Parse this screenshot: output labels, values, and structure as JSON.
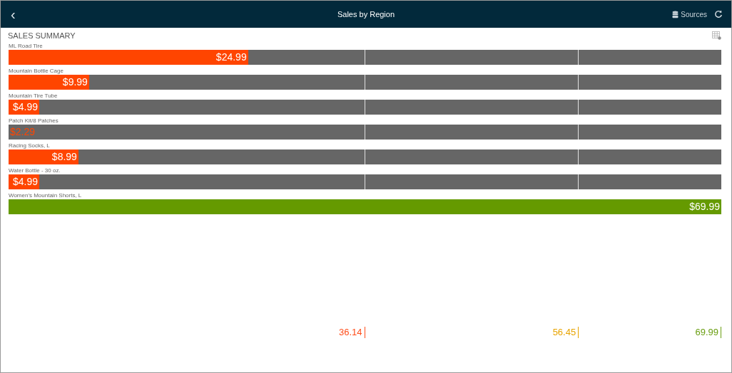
{
  "header": {
    "back": "‹",
    "title": "Sales by Region",
    "sources": "Sources"
  },
  "section_title": "SALES SUMMARY",
  "items": [
    {
      "label": "ML Road Tire",
      "value": "$24.99",
      "level": 0.336,
      "color": "#ff4500"
    },
    {
      "label": "Mountain Bottle Cage",
      "value": "$9.99",
      "level": 0.113,
      "color": "#ff4500"
    },
    {
      "label": "Mountain Tire Tube",
      "value": "$4.99",
      "level": 0.043,
      "color": "#ff4500"
    },
    {
      "label": "Patch Kit/8 Patches",
      "value": "$2.29",
      "level": 0,
      "color": "#ff4500"
    },
    {
      "label": "Racing Socks, L",
      "value": "$8.99",
      "level": 0.098,
      "color": "#ff4500"
    },
    {
      "label": "Water Bottle - 30 oz.",
      "value": "$4.99",
      "level": 0.043,
      "color": "#ff4500"
    },
    {
      "label": "Women's Mountain Shorts, L",
      "value": "$69.99",
      "level": 1,
      "color": "#659a00"
    }
  ],
  "thresholds": [
    {
      "value": "36.14",
      "color": "#ff4d1a"
    },
    {
      "value": "56.45",
      "color": "#e8a400"
    },
    {
      "value": "69.99",
      "color": "#6a9e12"
    }
  ]
}
